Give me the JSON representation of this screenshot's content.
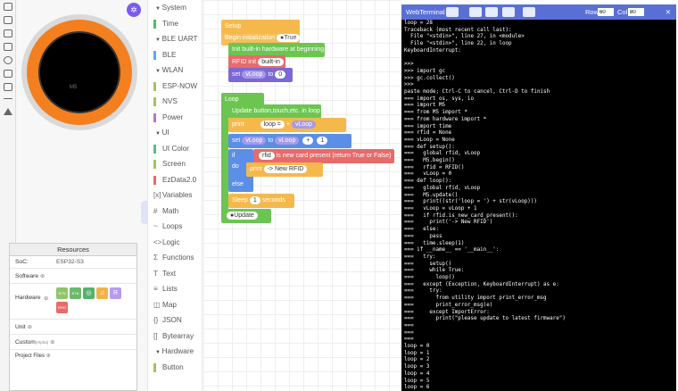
{
  "palette": {
    "items": [
      {
        "label": "System",
        "color": "#666666",
        "kind": "header"
      },
      {
        "label": "Time",
        "color": "#5cb85c"
      },
      {
        "label": "BLE UART",
        "color": "#666666",
        "kind": "header"
      },
      {
        "label": "BLE",
        "color": "#5ba5e6"
      },
      {
        "label": "WLAN",
        "color": "#666666",
        "kind": "header"
      },
      {
        "label": "ESP-NOW",
        "color": "#a0c460"
      },
      {
        "label": "NVS",
        "color": "#a0c460"
      },
      {
        "label": "Power",
        "color": "#c26fd6"
      },
      {
        "label": "UI",
        "color": "#666666",
        "kind": "header"
      },
      {
        "label": "UI Color",
        "color": "#5bbd85"
      },
      {
        "label": "Screen",
        "color": "#a0c460"
      },
      {
        "label": "EzData2.0",
        "color": "#e86a6a"
      },
      {
        "label": "Variables",
        "color": "#666666",
        "icon": "[x]"
      },
      {
        "label": "Math",
        "color": "#666666",
        "icon": "#"
      },
      {
        "label": "Loops",
        "color": "#666666",
        "icon": "~"
      },
      {
        "label": "Logic",
        "color": "#666666",
        "icon": "<>"
      },
      {
        "label": "Functions",
        "color": "#666666",
        "icon": "Σ"
      },
      {
        "label": "Text",
        "color": "#666666",
        "icon": "T"
      },
      {
        "label": "Lists",
        "color": "#666666",
        "icon": "≡"
      },
      {
        "label": "Map",
        "color": "#666666",
        "icon": "◫"
      },
      {
        "label": "JSON",
        "color": "#666666",
        "icon": "{}"
      },
      {
        "label": "Bytearray",
        "color": "#666666",
        "icon": "[]"
      },
      {
        "label": "Hardware",
        "color": "#666666",
        "kind": "header"
      },
      {
        "label": "Button",
        "color": "#a0c460"
      }
    ]
  },
  "blocks": {
    "setup_hat": "Setup",
    "begin_init": "Begin initialization",
    "true_toggle": "True",
    "init_hw": "Init built-in hardware at beginning",
    "rfid_init": "RFID init",
    "builtin": "built-in",
    "set_kw": "set",
    "to_kw": "to",
    "var_vloop": "vLoop",
    "zero_val": "0",
    "loop_hat": "Loop",
    "update_btn": "Update button,touch,etc. in loop",
    "print_kw": "print",
    "loop_eq": "loop = ",
    "plus": "+",
    "one": "1",
    "if_kw": "if",
    "rfid_var": "rfid",
    "new_card": "is new card present (return True or False)",
    "do_kw": "do",
    "new_rfid": "-> New RFID",
    "else_kw": "else",
    "sleep_kw": "Sleep",
    "seconds": "seconds",
    "update_toggle": "Update"
  },
  "terminal": {
    "title": "WebTerminal",
    "row_label": "Row",
    "row_value": "60",
    "col_label": "Col",
    "col_value": "80",
    "text": "loop = 28\nTraceback (most recent call last):\n  File \"<stdin>\", line 27, in <module>\n  File \"<stdin>\", line 22, in loop\nKeyboardInterrupt:\n\n>>>\n>>> import gc\n>>> gc.collect()\n>>>\npaste mode; Ctrl-C to cancel, Ctrl-D to finish\n=== import os, sys, io\n=== import M5\n=== from M5 import *\n=== from hardware import *\n=== import time\n=== rfid = None\n=== vLoop = None\n=== def setup():\n===   global rfid, vLoop\n===   M5.begin()\n===   rfid = RFID()\n===   vLoop = 0\n=== def loop():\n===   global rfid, vLoop\n===   M5.update()\n===   print((str('loop = ') + str(vLoop)))\n===   vLoop = vLoop + 1\n===   if rfid.is_new_card_present():\n===     print('-> New RFID')\n===   else:\n===     pass\n===   time.sleep(1)\n=== if __name__ == '__main__':\n===   try:\n===     setup()\n===     while True:\n===       loop()\n===   except (Exception, KeyboardInterrupt) as e:\n===     try:\n===       from utility import print_error_msg\n===       print_error_msg(e)\n===     except ImportError:\n===       print(\"please update to latest firmware\")\n===\n===\n===\nloop = 0\nloop = 1\nloop = 2\nloop = 3\nloop = 4\nloop = 5\nloop = 6\nloop = 7\nloop = 8"
  },
  "resources": {
    "title": "Resources",
    "soc_label": "SoC:",
    "soc_value": "ESP32-S3",
    "software_label": "Software",
    "hardware_label": "Hardware",
    "unit_label": "Unit",
    "custom_label": "Custom",
    "custom_badge": "(Alpha)",
    "project_files_label": "Project Files",
    "hw_chips": [
      "BTN",
      "BTN",
      "◎",
      "♫",
      "R"
    ],
    "rfid_chip": "RFID"
  }
}
